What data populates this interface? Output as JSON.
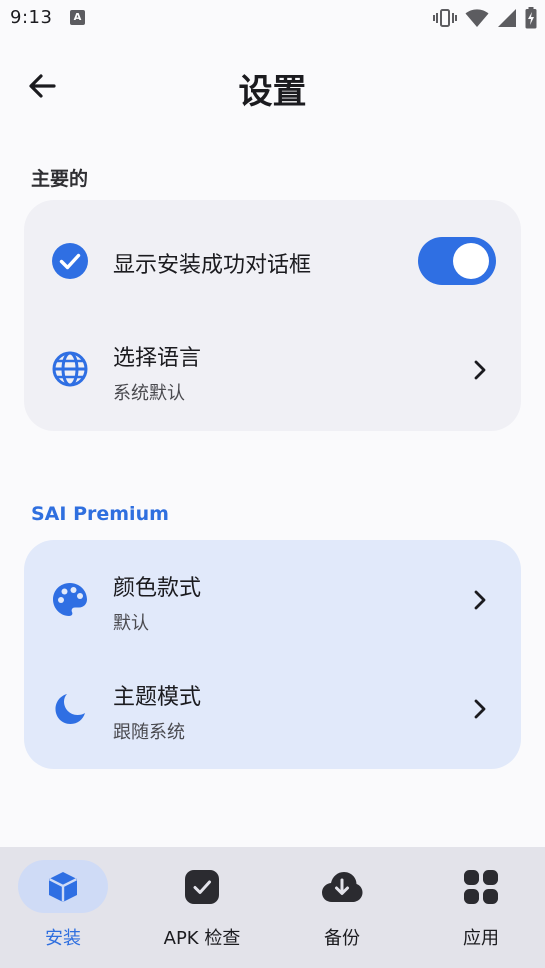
{
  "status_bar": {
    "time": "9:13",
    "notification_icon_letter": "A"
  },
  "app_bar": {
    "title": "设置",
    "back_icon": "arrow-left-icon"
  },
  "sections": {
    "main": {
      "header": "主要的",
      "items": [
        {
          "title": "显示安装成功对话框",
          "icon": "check-circle-icon",
          "toggle_on": true
        },
        {
          "title": "选择语言",
          "subtitle": "系统默认",
          "icon": "globe-icon"
        }
      ]
    },
    "premium": {
      "header": "SAI Premium",
      "items": [
        {
          "title": "颜色款式",
          "subtitle": "默认",
          "icon": "palette-icon"
        },
        {
          "title": "主题模式",
          "subtitle": "跟随系统",
          "icon": "moon-icon"
        }
      ]
    }
  },
  "bottom_nav": {
    "items": [
      {
        "label": "安装",
        "icon": "package-icon",
        "active": true
      },
      {
        "label": "APK 检查",
        "icon": "checkbox-icon",
        "active": false
      },
      {
        "label": "备份",
        "icon": "cloud-download-icon",
        "active": false
      },
      {
        "label": "应用",
        "icon": "apps-grid-icon",
        "active": false
      }
    ]
  },
  "colors": {
    "accent": "#2f6fe3",
    "background": "#fafafc",
    "card_main": "#f0f0f5",
    "card_premium": "#e1e9fa",
    "nav_background": "#e3e3ea",
    "nav_active_pill": "#cfdbf6"
  }
}
